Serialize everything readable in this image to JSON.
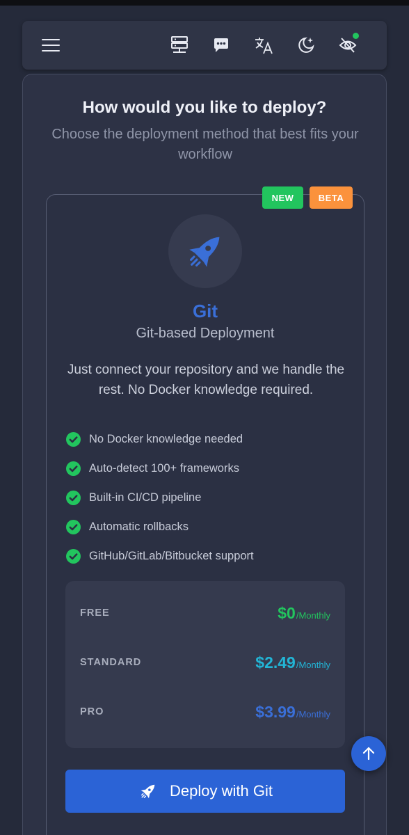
{
  "header": {
    "icons": [
      "menu-icon",
      "server-icon",
      "chat-icon",
      "translate-icon",
      "dark-mode-icon",
      "hide-icon"
    ]
  },
  "page": {
    "title": "How would you like to deploy?",
    "subtitle": "Choose the deployment method that best fits your workflow"
  },
  "option": {
    "badges": [
      "NEW",
      "BETA"
    ],
    "icon": "rocket-icon",
    "name": "Git",
    "subtitle": "Git-based Deployment",
    "description": "Just connect your repository and we handle the rest. No Docker knowledge required.",
    "features": [
      "No Docker knowledge needed",
      "Auto-detect 100+ frameworks",
      "Built-in CI/CD pipeline",
      "Automatic rollbacks",
      "GitHub/GitLab/Bitbucket support"
    ],
    "pricing": [
      {
        "tier": "FREE",
        "price": "$0",
        "period": "/Monthly",
        "color": "#22c55e"
      },
      {
        "tier": "STANDARD",
        "price": "$2.49",
        "period": "/Monthly",
        "color": "#22b5d6"
      },
      {
        "tier": "PRO",
        "price": "$3.99",
        "period": "/Monthly",
        "color": "#3a6fd8"
      }
    ],
    "cta": "Deploy with Git"
  },
  "colors": {
    "background": "#252a3a",
    "card": "#2d3245",
    "accent": "#2b63d6",
    "success": "#22c55e",
    "warning": "#fb923c"
  }
}
